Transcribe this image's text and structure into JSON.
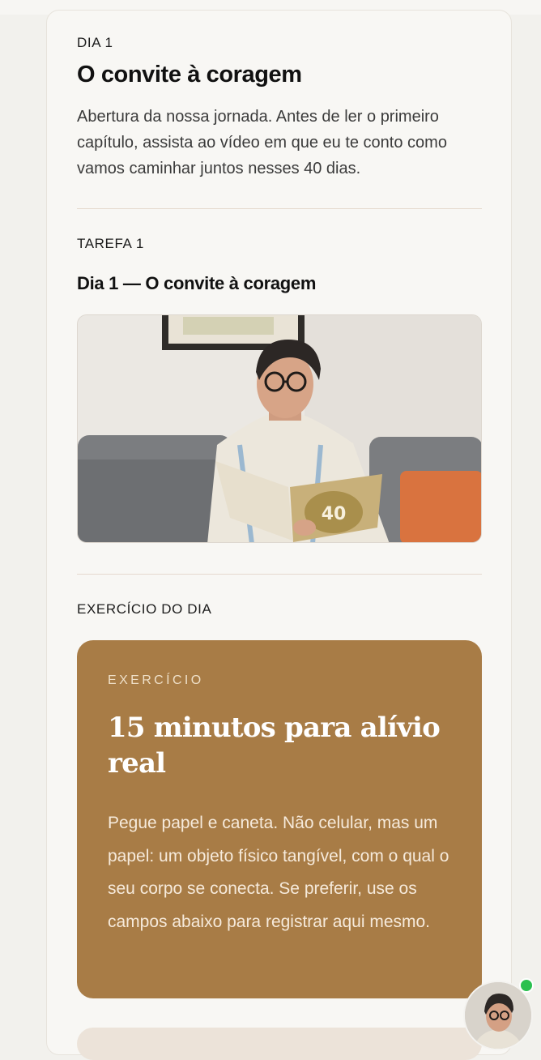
{
  "day": {
    "label": "DIA 1",
    "title": "O convite à coragem",
    "intro": "Abertura da nossa jornada. Antes de ler o primeiro capítulo, assista ao vídeo em que eu te conto como vamos caminhar juntos nesses 40 dias."
  },
  "task": {
    "label": "TAREFA 1",
    "title": "Dia 1 — O convite à coragem",
    "video": {
      "book_number": "40"
    }
  },
  "exercise": {
    "section_label": "EXERCÍCIO DO DIA",
    "kicker": "EXERCÍCIO",
    "title": "15 minutos para alívio real",
    "body": "Pegue papel e caneta. Não celular, mas um papel: um objeto físico tangível, com o qual o seu corpo se conecta. Se preferir, use os campos abaixo para registrar aqui mesmo."
  },
  "chat": {
    "status": "online",
    "status_color": "#2ac04f"
  },
  "colors": {
    "exercise_card": "#a87c46",
    "divider": "#e5d9ce",
    "page_background": "#f2f1ed"
  }
}
